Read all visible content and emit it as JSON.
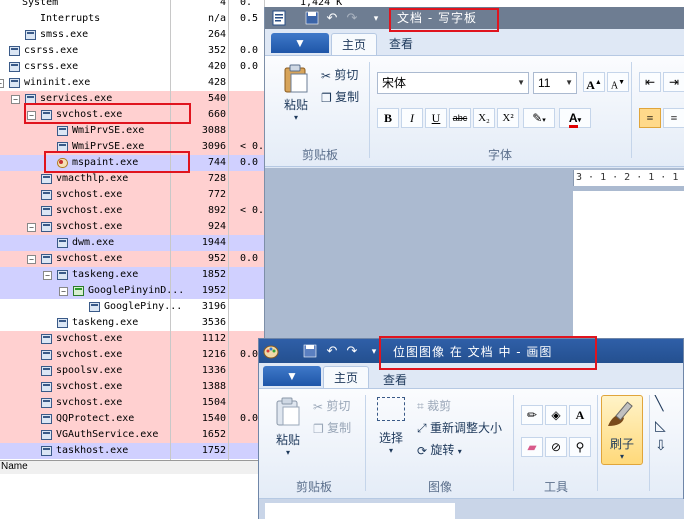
{
  "process_explorer": {
    "rows": [
      {
        "name": "System",
        "indent": 22,
        "icon": false,
        "c1": "4",
        "c2": "0.",
        "c3": "1,424 K"
      },
      {
        "name": "Interrupts",
        "indent": 40,
        "icon": false,
        "c1": "n/a",
        "c2": "0.5",
        "c3": ""
      },
      {
        "name": "smss.exe",
        "indent": 40,
        "icon": true,
        "c1": "264",
        "c2": "",
        "c3": ""
      },
      {
        "name": "csrss.exe",
        "indent": 24,
        "icon": true,
        "c1": "352",
        "c2": "0.0",
        "c3": ""
      },
      {
        "name": "csrss.exe",
        "indent": 24,
        "icon": true,
        "c1": "420",
        "c2": "0.0",
        "c3": ""
      },
      {
        "name": "wininit.exe",
        "indent": 24,
        "icon": true,
        "c1": "428",
        "c2": "",
        "c3": ""
      },
      {
        "name": "services.exe",
        "indent": 40,
        "icon": true,
        "c1": "540",
        "c2": "",
        "c3": ""
      },
      {
        "name": "svchost.exe",
        "indent": 56,
        "icon": true,
        "c1": "660",
        "c2": "",
        "c3": ""
      },
      {
        "name": "WmiPrvSE.exe",
        "indent": 72,
        "icon": true,
        "c1": "3088",
        "c2": "",
        "c3": ""
      },
      {
        "name": "WmiPrvSE.exe",
        "indent": 72,
        "icon": true,
        "c1": "3096",
        "c2": "< 0.0",
        "c3": ""
      },
      {
        "name": "mspaint.exe",
        "indent": 72,
        "icon": true,
        "c1": "744",
        "c2": "0.0",
        "c3": ""
      },
      {
        "name": "vmacthlp.exe",
        "indent": 56,
        "icon": true,
        "c1": "728",
        "c2": "",
        "c3": ""
      },
      {
        "name": "svchost.exe",
        "indent": 56,
        "icon": true,
        "c1": "772",
        "c2": "",
        "c3": ""
      },
      {
        "name": "svchost.exe",
        "indent": 56,
        "icon": true,
        "c1": "892",
        "c2": "< 0.0",
        "c3": ""
      },
      {
        "name": "svchost.exe",
        "indent": 56,
        "icon": true,
        "c1": "924",
        "c2": "",
        "c3": ""
      },
      {
        "name": "dwm.exe",
        "indent": 72,
        "icon": true,
        "c1": "1944",
        "c2": "",
        "c3": ""
      },
      {
        "name": "svchost.exe",
        "indent": 56,
        "icon": true,
        "c1": "952",
        "c2": "0.0",
        "c3": ""
      },
      {
        "name": "taskeng.exe",
        "indent": 72,
        "icon": true,
        "c1": "1852",
        "c2": "",
        "c3": ""
      },
      {
        "name": "GooglePinyinD...",
        "indent": 88,
        "icon": true,
        "c1": "1952",
        "c2": "",
        "c3": ""
      },
      {
        "name": "GooglePiny...",
        "indent": 104,
        "icon": true,
        "c1": "3196",
        "c2": "",
        "c3": ""
      },
      {
        "name": "taskeng.exe",
        "indent": 72,
        "icon": true,
        "c1": "3536",
        "c2": "",
        "c3": ""
      },
      {
        "name": "svchost.exe",
        "indent": 56,
        "icon": true,
        "c1": "1112",
        "c2": "",
        "c3": ""
      },
      {
        "name": "svchost.exe",
        "indent": 56,
        "icon": true,
        "c1": "1216",
        "c2": "0.0",
        "c3": ""
      },
      {
        "name": "spoolsv.exe",
        "indent": 56,
        "icon": true,
        "c1": "1336",
        "c2": "",
        "c3": ""
      },
      {
        "name": "svchost.exe",
        "indent": 56,
        "icon": true,
        "c1": "1388",
        "c2": "",
        "c3": ""
      },
      {
        "name": "svchost.exe",
        "indent": 56,
        "icon": true,
        "c1": "1504",
        "c2": "",
        "c3": ""
      },
      {
        "name": "QQProtect.exe",
        "indent": 56,
        "icon": true,
        "c1": "1540",
        "c2": "0.0",
        "c3": ""
      },
      {
        "name": "VGAuthService.exe",
        "indent": 56,
        "icon": true,
        "c1": "1652",
        "c2": "",
        "c3": ""
      },
      {
        "name": "taskhost.exe",
        "indent": 56,
        "icon": true,
        "c1": "1752",
        "c2": "",
        "c3": ""
      }
    ],
    "status_label": "Name",
    "colors": {
      "service": "#ffd0d0",
      "own": "#d0d0ff",
      "plain": "#ffffff",
      "highlight_box": "#e0141e"
    }
  },
  "wordpad": {
    "title": "文档 - 写字板",
    "file_button": "▼",
    "tabs": [
      "主页",
      "查看"
    ],
    "clipboard": {
      "paste": "粘贴",
      "cut": "剪切",
      "copy": "复制",
      "group": "剪贴板"
    },
    "font": {
      "name": "宋体",
      "size": "11",
      "group": "字体"
    },
    "format_buttons": [
      "B",
      "I",
      "U",
      "abc",
      "X₂",
      "X²"
    ],
    "ruler": "3 · 1 · 2 · 1 · 1 · 1 ·"
  },
  "paint": {
    "title": "位图图像 在 文档 中 - 画图",
    "file_button": "▼",
    "tabs": [
      "主页",
      "查看"
    ],
    "clipboard": {
      "paste": "粘贴",
      "cut": "剪切",
      "copy": "复制",
      "group": "剪贴板"
    },
    "image": {
      "select": "选择",
      "crop": "裁剪",
      "resize": "重新调整大小",
      "rotate": "旋转",
      "group": "图像"
    },
    "tools": {
      "group": "工具"
    },
    "brushes": {
      "label": "刷子"
    }
  }
}
